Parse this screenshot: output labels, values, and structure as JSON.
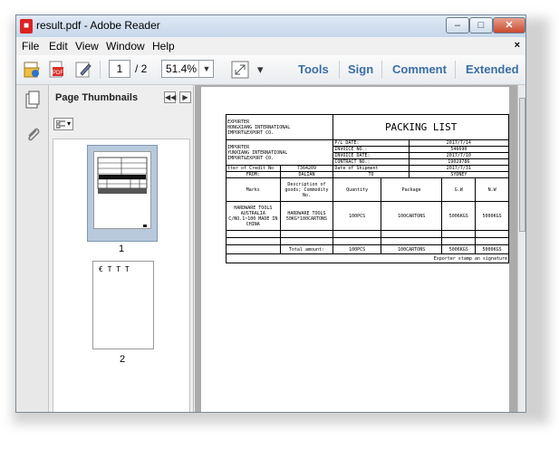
{
  "window": {
    "title": "result.pdf - Adobe Reader",
    "controls": [
      "–",
      "□",
      "✕"
    ]
  },
  "menu": {
    "items": [
      "File",
      "Edit",
      "View",
      "Window",
      "Help"
    ],
    "close_doc": "×"
  },
  "toolbar": {
    "page_current": "1",
    "page_total": "/ 2",
    "zoom": "51.4%",
    "zoom_dropdown": "▼",
    "more": "▾",
    "links": [
      "Tools",
      "Sign",
      "Comment",
      "Extended"
    ]
  },
  "panel": {
    "title": "Page Thumbnails",
    "options": "▾",
    "thumb1_label": "1",
    "thumb2_label": "2",
    "thumb2_text": "€ Τ Τ Τ"
  },
  "colors": {
    "link": "#3a6ea5",
    "selection": "#b8c9dc",
    "title_bar": "#c6d7ea"
  },
  "document": {
    "heading": "PACKING LIST",
    "exporter_label": "EXPORTER",
    "exporter_name": "HONGXIANG INTERNATIONAL",
    "exporter_name2": "IMPORT&EXPORT CO.",
    "importer_label": "IMPORTER",
    "importer_name": "YUNXIANG INTERNATIONAL",
    "importer_name2": "IMPORT&EXPORT CO.",
    "pl_date_label": "P/L DATE:",
    "pl_date": "2017/7/14",
    "invoice_no_label": "INVOICE NO.:",
    "invoice_no": "546690",
    "invoice_date_label": "INVOICE DATE:",
    "invoice_date": "2017/7/10",
    "contract_no_label": "CONTRACT NO.:",
    "contract_no": "19029786",
    "lc_label": "tter of Credit No",
    "lc_no": "7364209",
    "shipment_date_label": "Date of Shipment",
    "shipment_date": "2017/7/31",
    "from_label": "FROM:",
    "from": "DALIAN",
    "to_label": "TO",
    "to": "SYDNEY",
    "col_marks": "Marks",
    "col_desc": "Description of goods; Commodity No.",
    "col_qty": "Quantity",
    "col_pkg": "Package",
    "col_gw": "G.W",
    "col_nw": "N.W",
    "marks_text": "HARDWARE TOOLS AUSTRALIA C/NO.1~100 MADE IN CHINA",
    "desc_text": "HARDWARE TOOLS 50KG*100CARTONS",
    "qty": "100PCS",
    "pkg": "100CARTONS",
    "gw": "5006KGS",
    "nw": "5000KGS",
    "total_label": "Total amount:",
    "total_qty": "100PCS",
    "total_pkg": "100CARTONS",
    "total_gw": "5006KGS",
    "total_nw": "5000KGS",
    "signature": "Exporter stamp an signature"
  }
}
